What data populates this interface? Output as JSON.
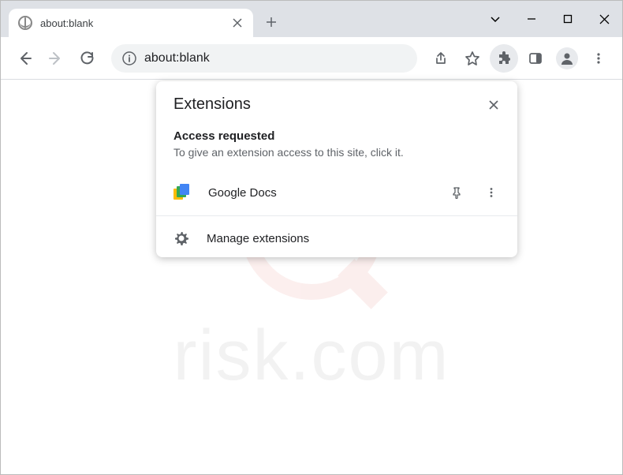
{
  "tab": {
    "title": "about:blank"
  },
  "omnibox": {
    "url": "about:blank"
  },
  "popup": {
    "title": "Extensions",
    "section_heading": "Access requested",
    "section_desc": "To give an extension access to this site, click it.",
    "extension_name": "Google Docs",
    "manage_label": "Manage extensions"
  },
  "watermark": {
    "text": "risk.com"
  }
}
